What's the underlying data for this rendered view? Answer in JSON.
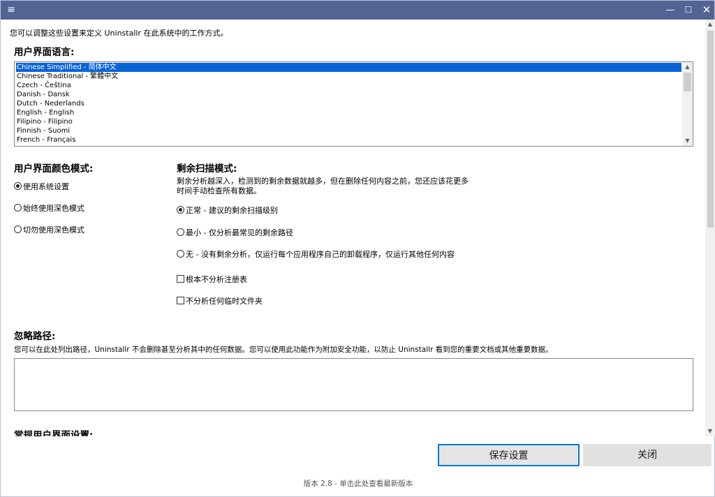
{
  "titlebar": {
    "menu_icon": "≡",
    "minimize_icon": "—",
    "maximize_icon": "☐",
    "close_icon": "✕"
  },
  "intro_text": "您可以调整这些设置来定义 Uninstallr 在此系统中的工作方式。",
  "language": {
    "heading": "用户界面语言:",
    "items": [
      "Chinese Simplified - 简体中文",
      "Chinese Traditional - 繁體中文",
      "Czech - Čeština",
      "Danish - Dansk",
      "Dutch - Nederlands",
      "English - English",
      "Filipino - Filipino",
      "Finnish - Suomi",
      "French - Français"
    ],
    "selected_index": 0
  },
  "color_mode": {
    "heading": "用户界面颜色模式:",
    "options": [
      "使用系统设置",
      "始终使用深色模式",
      "切勿使用深色模式"
    ],
    "selected_index": 0
  },
  "leftover_scan": {
    "heading": "剩余扫描模式:",
    "description_line1": "剩余分析越深入，检测到的剩余数据就越多，但在删除任何内容之前，您还应该花更多",
    "description_line2": "时间手动检查所有数据。",
    "options": [
      "正常 - 建议的剩余扫描级别",
      "最小 - 仅分析最常见的剩余路径",
      "无 - 没有剩余分析，仅运行每个应用程序自己的卸载程序，仅运行其他任何内容"
    ],
    "selected_index": 0,
    "checkboxes": [
      "根本不分析注册表",
      "不分析任何临时文件夹"
    ]
  },
  "ignore_paths": {
    "heading": "忽略路径:",
    "description": "您可以在此处列出路径，Uninstallr 不会删除甚至分析其中的任何数据。您可以使用此功能作为附加安全功能，以防止 Uninstallr 看到您的重要文档或其他重要数据。",
    "value": ""
  },
  "general_ui": {
    "heading": "常规用户界面设置:"
  },
  "buttons": {
    "save": "保存设置",
    "close": "关闭"
  },
  "footer": "版本 2.8 - 单击此处查看最新版本",
  "colors": {
    "titlebar": "#536494",
    "selection": "#0a64d6",
    "button_focus": "#0078d7"
  }
}
